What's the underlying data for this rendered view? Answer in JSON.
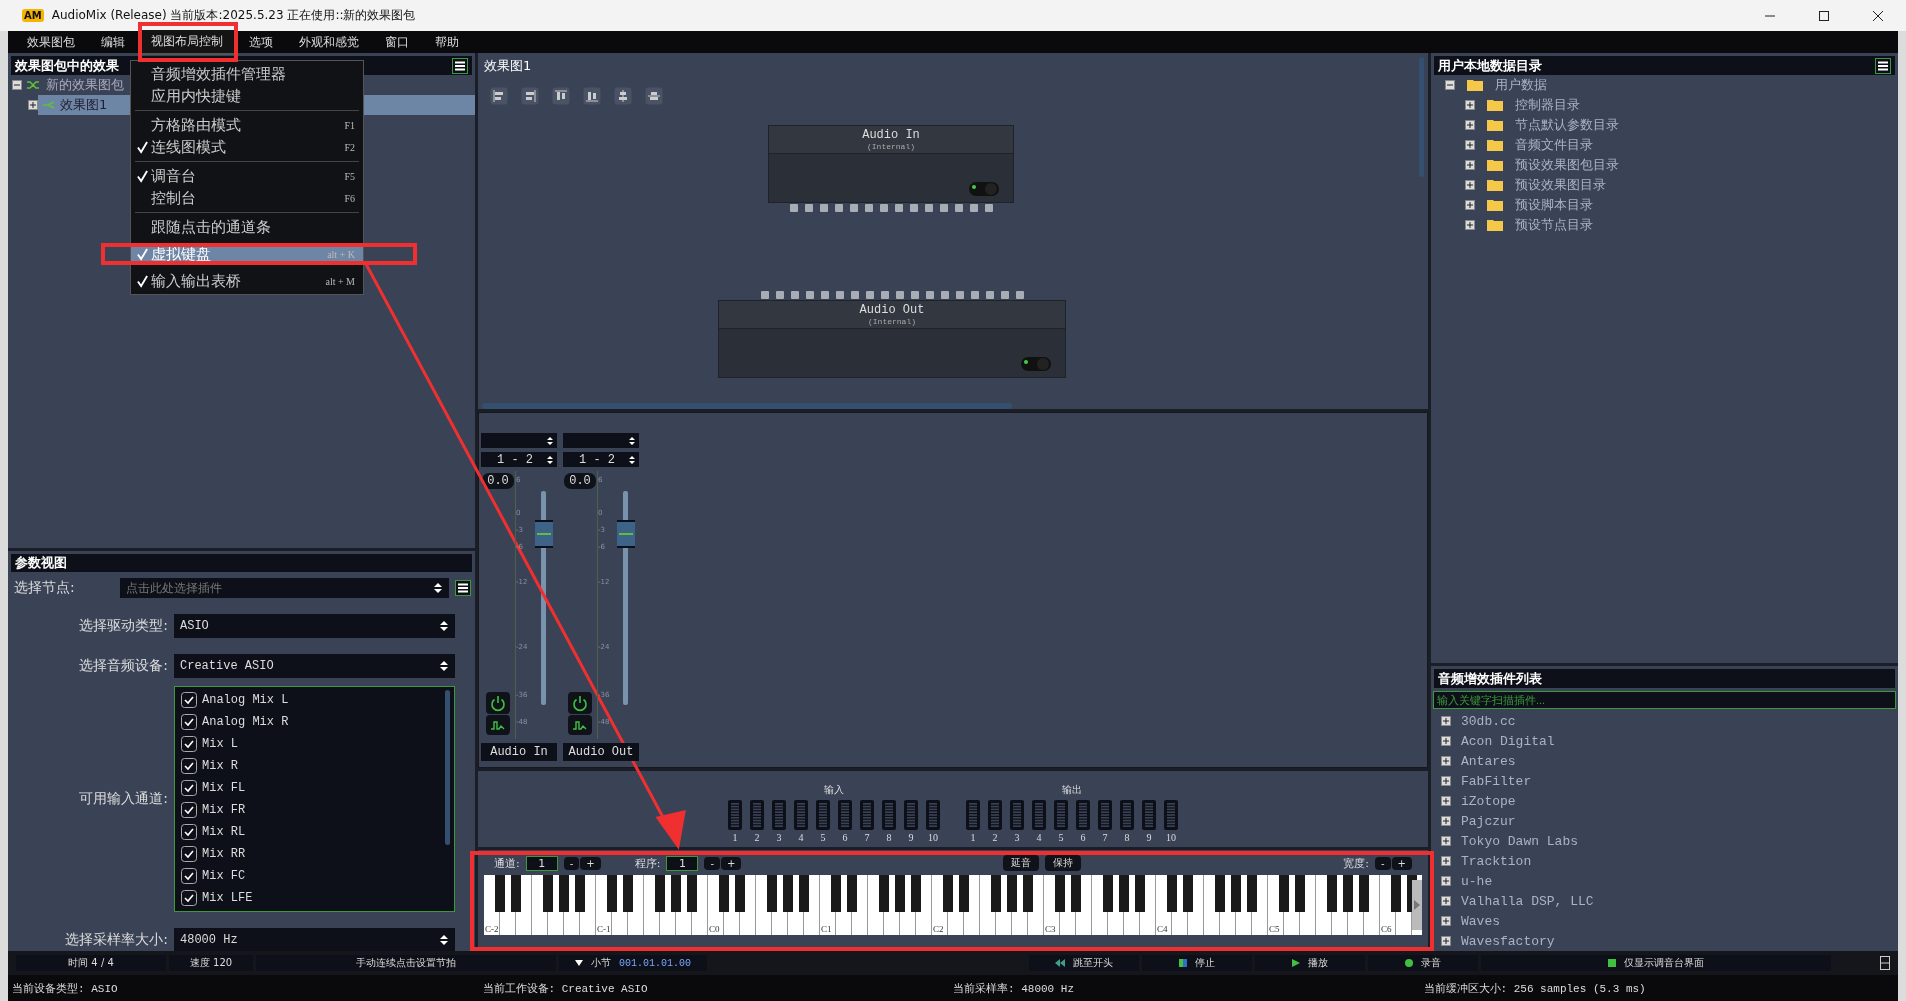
{
  "title_bar": {
    "logo": "AM",
    "title": "AudioMix (Release) 当前版本:2025.5.23 正在使用::新的效果图包"
  },
  "menu_bar": [
    {
      "label": "效果图包",
      "selected": false
    },
    {
      "label": "编辑",
      "selected": false
    },
    {
      "label": "视图布局控制",
      "selected": true
    },
    {
      "label": "选项",
      "selected": false
    },
    {
      "label": "外观和感觉",
      "selected": false
    },
    {
      "label": "窗口",
      "selected": false
    },
    {
      "label": "帮助",
      "selected": false
    }
  ],
  "menu": [
    {
      "kind": "item",
      "label": "音频增效插件管理器",
      "checked": false,
      "selected": false
    },
    {
      "kind": "item",
      "label": "应用内快捷键",
      "checked": false,
      "selected": false
    },
    {
      "kind": "separator"
    },
    {
      "kind": "item",
      "label": "方格路由模式",
      "shortcut": "F1",
      "checked": false,
      "selected": false
    },
    {
      "kind": "item",
      "label": "连线图模式",
      "shortcut": "F2",
      "checked": true,
      "selected": false
    },
    {
      "kind": "separator"
    },
    {
      "kind": "item",
      "label": "调音台",
      "shortcut": "F5",
      "checked": true,
      "selected": false
    },
    {
      "kind": "item",
      "label": "控制台",
      "shortcut": "F6",
      "checked": false,
      "selected": false
    },
    {
      "kind": "separator"
    },
    {
      "kind": "item",
      "label": "跟随点击的通道条",
      "checked": false,
      "selected": false
    },
    {
      "kind": "item",
      "label": "虚拟键盘",
      "shortcut": "alt + K",
      "checked": true,
      "selected": true
    },
    {
      "kind": "item",
      "label": "输入输出表桥",
      "shortcut": "alt + M",
      "checked": true,
      "selected": false
    }
  ],
  "effects_panel": {
    "title": "效果图包中的效果",
    "tree": [
      {
        "label": "新的效果图包",
        "expanded": true,
        "selected": false,
        "children": [
          {
            "label": "效果图1",
            "expanded": false,
            "selected": true
          }
        ]
      }
    ]
  },
  "param_view": {
    "title": "参数视图",
    "node_label": "选择节点:",
    "node_placeholder": "点击此处选择插件",
    "fields": [
      {
        "label": "选择驱动类型:",
        "value": "ASIO"
      },
      {
        "label": "选择音频设备:",
        "value": "Creative ASIO"
      }
    ],
    "channels_label": "可用输入通道:",
    "channels": [
      {
        "name": "Analog Mix L",
        "checked": true
      },
      {
        "name": "Analog Mix R",
        "checked": true
      },
      {
        "name": "Mix L",
        "checked": true
      },
      {
        "name": "Mix R",
        "checked": true
      },
      {
        "name": "Mix FL",
        "checked": true
      },
      {
        "name": "Mix FR",
        "checked": true
      },
      {
        "name": "Mix RL",
        "checked": true
      },
      {
        "name": "Mix RR",
        "checked": true
      },
      {
        "name": "Mix FC",
        "checked": true
      },
      {
        "name": "Mix LFE",
        "checked": true
      }
    ],
    "sample_rate": {
      "label": "选择采样率大小:",
      "value": "48000 Hz"
    }
  },
  "graph": {
    "title": "效果图1",
    "nodes": [
      {
        "kind": "source",
        "name": "Audio In",
        "subtitle": "(Internal)"
      },
      {
        "kind": "sink",
        "name": "Audio Out",
        "subtitle": "(Internal)"
      }
    ]
  },
  "mixer": {
    "strips": [
      {
        "route": "1 - 2",
        "gain": "0.0",
        "name": "Audio In",
        "power": true,
        "scale": [
          "6",
          "0",
          "-3",
          "-6",
          "-12",
          "-24",
          "-36",
          "-48"
        ]
      },
      {
        "route": "1 - 2",
        "gain": "0.0",
        "name": "Audio Out",
        "power": true,
        "scale": [
          "6",
          "0",
          "-3",
          "-6",
          "-12",
          "-24",
          "-36",
          "-48"
        ]
      }
    ]
  },
  "meters": {
    "input_label": "输入",
    "output_label": "输出",
    "input_channels": [
      "1",
      "2",
      "3",
      "4",
      "5",
      "6",
      "7",
      "8",
      "9",
      "10"
    ],
    "output_channels": [
      "1",
      "2",
      "3",
      "4",
      "5",
      "6",
      "7",
      "8",
      "9",
      "10"
    ]
  },
  "keyboard": {
    "channel_label": "通道:",
    "channel": "1",
    "program_label": "程序:",
    "program": "1",
    "sustain": "延音",
    "hold": "保持",
    "width_label": "宽度:",
    "channel_steps": [
      "-",
      "+"
    ],
    "program_steps": [
      "-",
      "+"
    ],
    "width_steps": [
      "-",
      "+"
    ],
    "octaves": [
      "C-2",
      "C-1",
      "C0",
      "C1",
      "C2",
      "C3",
      "C4",
      "C5",
      "C6"
    ]
  },
  "transport": [
    {
      "kind": "text",
      "label": "时间 4 / 4"
    },
    {
      "kind": "text",
      "label": "速度 120"
    },
    {
      "kind": "text",
      "label": "手动连续点击设置节拍"
    },
    {
      "kind": "position",
      "label": "小节",
      "value": "001.01.01.00"
    },
    {
      "kind": "rewind",
      "label": "跳至开头"
    },
    {
      "kind": "stop",
      "label": "停止"
    },
    {
      "kind": "play",
      "label": "播放"
    },
    {
      "kind": "record",
      "label": "录音"
    },
    {
      "kind": "mixer",
      "label": "仅显示调音台界面"
    }
  ],
  "status_bar": [
    "当前设备类型: ASIO",
    "当前工作设备: Creative ASIO",
    "当前采样率:  48000 Hz",
    "当前缓冲区大小: 256 samples (5.3 ms)"
  ],
  "data_dir": {
    "title": "用户本地数据目录",
    "tree": [
      {
        "label": "用户数据",
        "expanded": true,
        "children": [
          {
            "label": "控制器目录",
            "expanded": false
          },
          {
            "label": "节点默认参数目录",
            "expanded": false
          },
          {
            "label": "音频文件目录",
            "expanded": false
          },
          {
            "label": "预设效果图包目录",
            "expanded": false
          },
          {
            "label": "预设效果图目录",
            "expanded": false
          },
          {
            "label": "预设脚本目录",
            "expanded": false
          },
          {
            "label": "预设节点目录",
            "expanded": false
          }
        ]
      }
    ]
  },
  "plugins": {
    "title": "音频增效插件列表",
    "search_placeholder": "输入关键字扫描插件...",
    "vendors": [
      {
        "label": "30db.cc",
        "expanded": false
      },
      {
        "label": "Acon Digital",
        "expanded": false
      },
      {
        "label": "Antares",
        "expanded": false
      },
      {
        "label": "FabFilter",
        "expanded": false
      },
      {
        "label": "iZotope",
        "expanded": false
      },
      {
        "label": "Pajczur",
        "expanded": false
      },
      {
        "label": "Tokyo Dawn Labs",
        "expanded": false
      },
      {
        "label": "Tracktion",
        "expanded": false
      },
      {
        "label": "u-he",
        "expanded": false
      },
      {
        "label": "Valhalla DSP, LLC",
        "expanded": false
      },
      {
        "label": "Waves",
        "expanded": false
      },
      {
        "label": "Wavesfactory",
        "expanded": false
      }
    ]
  }
}
